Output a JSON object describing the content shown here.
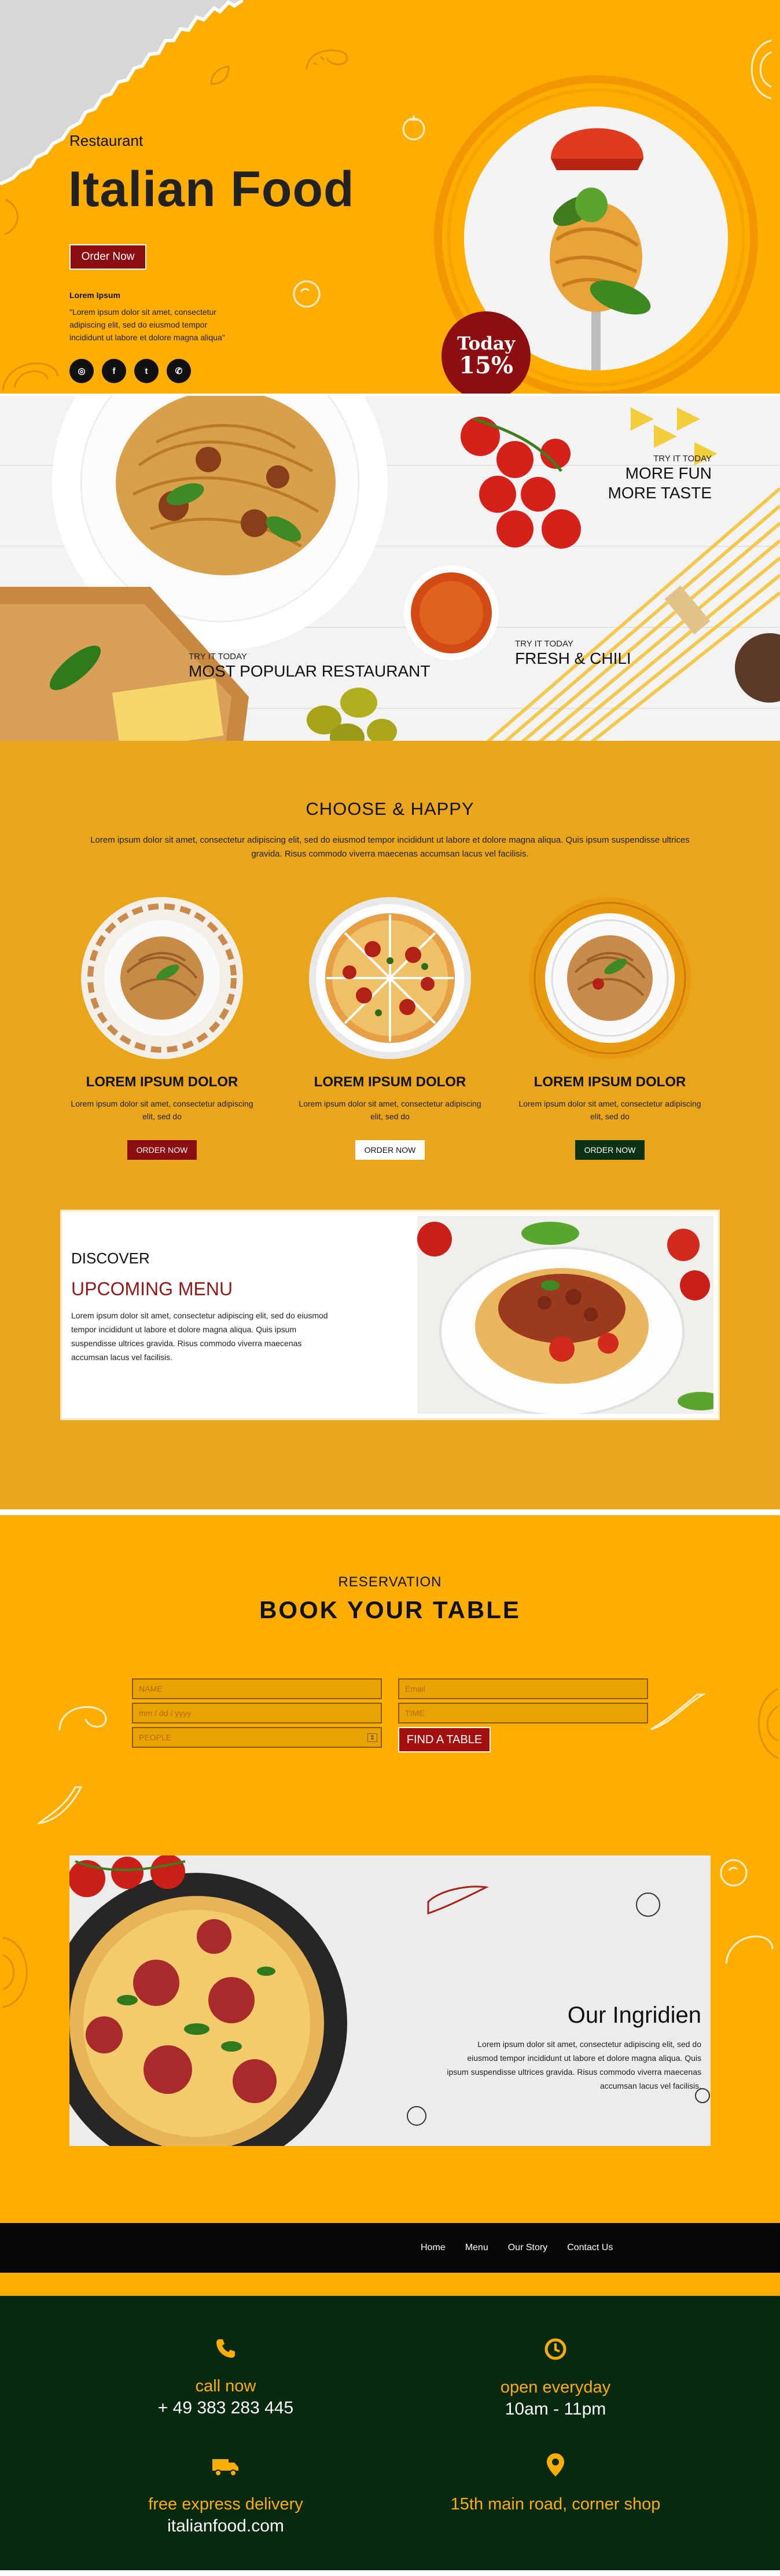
{
  "colors": {
    "accent": "#fead01",
    "brand_red": "#8b0f12",
    "dark_green": "#07290f",
    "choose_bg": "#eaa61a"
  },
  "hero": {
    "kicker": "Restaurant",
    "title": "Italian Food",
    "order_label": "Order Now",
    "small_title": "Lorem Ipsum",
    "quote": "\"Lorem ipsum dolor sit amet, consectetur adipiscing elit, sed do eiusmod tempor incididunt ut labore et dolore magna aliqua\"",
    "socials": [
      {
        "icon": "instagram-icon",
        "glyph": "◎"
      },
      {
        "icon": "facebook-icon",
        "glyph": "f"
      },
      {
        "icon": "twitter-icon",
        "glyph": "t"
      },
      {
        "icon": "whatsapp-icon",
        "glyph": "✆"
      }
    ],
    "badge_line1": "Today",
    "badge_line2": "15%"
  },
  "banner": {
    "tags": [
      {
        "small": "TRY IT TODAY",
        "big": "MOST POPULAR RESTAURANT"
      },
      {
        "small": "TRY IT TODAY",
        "big1": "MORE FUN",
        "big2": "MORE TASTE"
      },
      {
        "small": "TRY IT TODAY",
        "big": "FRESH & CHILI"
      }
    ]
  },
  "choose": {
    "title": "CHOOSE & HAPPY",
    "desc": "Lorem ipsum dolor sit amet, consectetur adipiscing elit, sed do eiusmod tempor incididunt ut labore et dolore magna aliqua. Quis ipsum suspendisse ultrices gravida. Risus commodo viverra maecenas accumsan lacus vel facilisis.",
    "dishes": [
      {
        "name": "LOREM IPSUM DOLOR",
        "desc": "Lorem ipsum dolor sit amet, consectetur adipiscing elit, sed do",
        "button": "ORDER NOW"
      },
      {
        "name": "LOREM IPSUM DOLOR",
        "desc": "Lorem ipsum dolor sit amet, consectetur adipiscing elit, sed do",
        "button": "ORDER NOW"
      },
      {
        "name": "LOREM IPSUM DOLOR",
        "desc": "Lorem ipsum dolor sit amet, consectetur adipiscing elit, sed do",
        "button": "ORDER NOW"
      }
    ],
    "discover": {
      "kicker": "DISCOVER",
      "title": "UPCOMING MENU",
      "desc": "Lorem ipsum dolor sit amet, consectetur adipiscing elit, sed do eiusmod tempor incididunt ut labore et dolore magna aliqua. Quis ipsum suspendisse ultrices gravida. Risus commodo viverra maecenas accumsan lacus vel facilisis."
    }
  },
  "reservation": {
    "kicker": "RESERVATION",
    "title": "BOOK YOUR TABLE",
    "name_placeholder": "NAME",
    "email_placeholder": "Email",
    "date_placeholder": "mm / dd / yyyy",
    "time_placeholder": "TIME",
    "people_placeholder": "PEOPLE",
    "find_label": "FIND A TABLE"
  },
  "ingredients": {
    "title": "Our Ingridien",
    "desc": "Lorem ipsum dolor sit amet, consectetur adipiscing elit, sed do eiusmod tempor incididunt ut labore et dolore magna aliqua. Quis ipsum suspendisse ultrices gravida. Risus commodo viverra maecenas accumsan lacus vel facilisis."
  },
  "nav": {
    "items": [
      "Home",
      "Menu",
      "Our Story",
      "Contact Us"
    ]
  },
  "footer": {
    "call_label": "call now",
    "call_value": "+ 49 383 283 445",
    "hours_label": "open everyday",
    "hours_value": "10am - 11pm",
    "delivery_label": "free express delivery",
    "delivery_value": "italianfood.com",
    "address_label": "15th main road, corner shop"
  }
}
